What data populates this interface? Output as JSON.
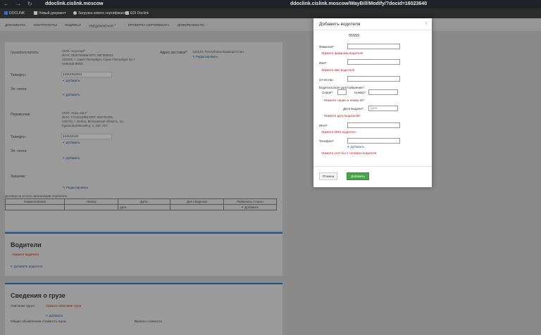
{
  "browser": {
    "url_left": "ddoclink.cislink.moscow",
    "url_right": "ddoclink.cislink.moscow/WayBill/Modify/?docid=16023640",
    "bookmarks": [
      "DOCLINK",
      "Новый документ",
      "Загрузка нового сертификата",
      "EDI Doclink"
    ]
  },
  "menu": [
    "ДОКУМЕНТЫ",
    "КОНТРАГЕНТЫ",
    "ПОДПИСИ",
    "УВЕДОМЛЕНИЯ",
    "ПРОВЕРКА СЕРТИФИКАТА",
    "ДОВЕРЕННОСТИ"
  ],
  "menu_badge": "1",
  "consignee": {
    "label": "Грузополучатель:",
    "name": "ООО \"Агроторг\"",
    "inn_kpp": "ИНН: 7825706086 КПП: 997350001",
    "address_1": "191025, г. Санкт-Петербург, Санкт-Петербург пр-т",
    "address_2": "Невский 90/92",
    "delivery_label": "Адрес доставки*:",
    "delivery_value": "123123, Республика Башкортостан,",
    "edit": "Редактировать",
    "phone_label": "Телефон:",
    "phone_value": "12312312321",
    "add": "Добавить",
    "email_label": "Эл. почта:",
    "add_email": "Добавить"
  },
  "carrier": {
    "label": "Перевозчик:",
    "name": "ООО \"Агро-Авто\"",
    "inn_kpp": "ИНН: 7714211089 КПП: 504701001",
    "address_1": "141734, г. Лобня, Московская область, пр.",
    "address_2": "Краснополянский д. 1, лит. 217",
    "phone_label": "Телефон:",
    "phone_value": "123132132",
    "add": "Добавить",
    "email_label": "Эл. почта:",
    "add_email": "Добавить"
  },
  "customer": {
    "label": "Заказчик:",
    "edit": "Редактировать"
  },
  "contract": {
    "label": "Договор на услуги организации перевозок:",
    "headers": [
      "Наименование",
      "Номер",
      "Дата",
      "Доп.сведения",
      "Реквизиты сторон"
    ],
    "date_placeholder": "дата",
    "add": "Добавить"
  },
  "drivers": {
    "title": "Водители",
    "error": "Укажите водителя",
    "add": "Добавить водителя"
  },
  "cargo": {
    "title": "Сведения о грузе",
    "desc_label": "Описание груза:",
    "desc_error": "Укажите описание груза",
    "add": "Добавить",
    "total_label": "Общая объявленная стоимость груза:",
    "currency_label": "Валюта стоимости:"
  },
  "modal": {
    "title": "Добавить водителя",
    "close": "x",
    "code": "55555",
    "surname_label": "Фамилия*:",
    "surname_error": "Укажите фамилию водителя",
    "name_label": "Имя*:",
    "name_error": "Укажите имя водителя",
    "patronymic_label": "Отчество:",
    "license_label": "Водительское удостоверение*:",
    "series_label": "Серия*:",
    "number_label": "Номер*:",
    "license_error": "Укажите серию и номер ВУ",
    "issue_date_label": "Дата выдачи*:",
    "issue_date_placeholder": "дата",
    "issue_date_error": "Укажите дату выдачи ВУ",
    "inn_label": "ИНН*:",
    "inn_error": "Укажите ИНН водителя",
    "phone_label": "Телефон*:",
    "phone_add": "Добавить",
    "phone_error": "Укажите хотя бы 1 телефон водителя",
    "cancel": "Отмена",
    "submit": "Добавить"
  },
  "colors": {
    "accent_blue": "#1c4f86",
    "error_red": "#b32020",
    "submit_green": "#46a546"
  }
}
